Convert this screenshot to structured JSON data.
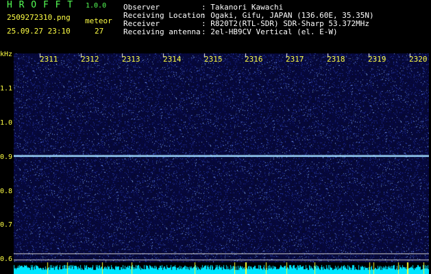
{
  "app": {
    "logo": "H R O F F T",
    "version": "1.0.0",
    "file_name": "2509272310.png",
    "datetime": "25.09.27 23:10",
    "meteor_label": "meteor",
    "meteor_count": "27"
  },
  "info": {
    "rows": [
      {
        "label": "Observer",
        "value": ": Takanori Kawachi"
      },
      {
        "label": "Receiving Location",
        "value": ": Ogaki, Gifu, JAPAN (136.60E, 35.35N)"
      },
      {
        "label": "Receiver",
        "value": ": R820T2(RTL-SDR) SDR-Sharp 53.372MHz"
      },
      {
        "label": "Receiving antenna",
        "value": ": 2el-HB9CV Vertical (el. E-W)"
      }
    ]
  },
  "axis": {
    "unit": "kHz",
    "time_ticks": [
      "2311",
      "2312",
      "2313",
      "2314",
      "2315",
      "2316",
      "2317",
      "2318",
      "2319",
      "2320"
    ],
    "freq_ticks": [
      "1.1",
      "1.0",
      "0.9",
      "0.8",
      "0.7",
      "0.6"
    ]
  },
  "colors": {
    "background": "#000000",
    "waterfall_base": "#0a0a3a",
    "carrier_line": "#9ad8ff",
    "label_yellow": "#ffff44",
    "label_green": "#55ff55",
    "bottom_bar": "#00e5ff"
  }
}
